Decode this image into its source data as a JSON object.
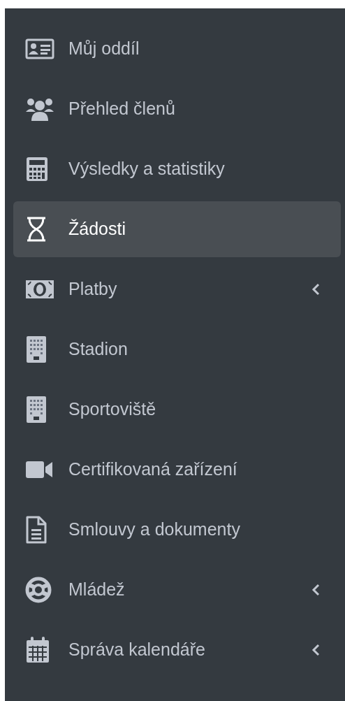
{
  "sidebar": {
    "items": [
      {
        "label": "Můj oddíl",
        "kind": "idcard",
        "selected": false,
        "has_submenu": false
      },
      {
        "label": "Přehled členů",
        "kind": "users",
        "selected": false,
        "has_submenu": false
      },
      {
        "label": "Výsledky a statistiky",
        "kind": "calculator",
        "selected": false,
        "has_submenu": false
      },
      {
        "label": "Žádosti",
        "kind": "hourglass",
        "selected": true,
        "has_submenu": false
      },
      {
        "label": "Platby",
        "kind": "money",
        "selected": false,
        "has_submenu": true
      },
      {
        "label": "Stadion",
        "kind": "building",
        "selected": false,
        "has_submenu": false
      },
      {
        "label": "Sportoviště",
        "kind": "building",
        "selected": false,
        "has_submenu": false
      },
      {
        "label": "Certifikovaná zařízení",
        "kind": "video",
        "selected": false,
        "has_submenu": false
      },
      {
        "label": "Smlouvy a dokumenty",
        "kind": "file",
        "selected": false,
        "has_submenu": false
      },
      {
        "label": "Mládež",
        "kind": "lifering",
        "selected": false,
        "has_submenu": true
      },
      {
        "label": "Správa kalendáře",
        "kind": "calendar",
        "selected": false,
        "has_submenu": true
      }
    ]
  }
}
